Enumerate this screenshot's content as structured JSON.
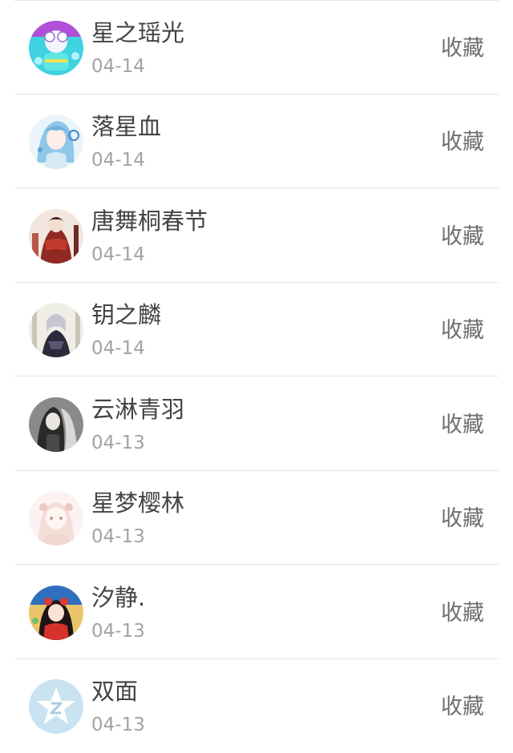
{
  "users": [
    {
      "name": "星之瑶光",
      "date": "04-14",
      "action": "收藏",
      "avatar_icon": "anime-cat-ears-avatar-icon"
    },
    {
      "name": "落星血",
      "date": "04-14",
      "action": "收藏",
      "avatar_icon": "anime-blue-hair-avatar-icon"
    },
    {
      "name": "唐舞桐春节",
      "date": "04-14",
      "action": "收藏",
      "avatar_icon": "anime-red-dress-avatar-icon"
    },
    {
      "name": "钥之麟",
      "date": "04-14",
      "action": "收藏",
      "avatar_icon": "anime-dark-dress-avatar-icon"
    },
    {
      "name": "云淋青羽",
      "date": "04-13",
      "action": "收藏",
      "avatar_icon": "anime-grey-sketch-avatar-icon"
    },
    {
      "name": "星梦樱林",
      "date": "04-13",
      "action": "收藏",
      "avatar_icon": "anime-pastel-avatar-icon"
    },
    {
      "name": "汐静.",
      "date": "04-13",
      "action": "收藏",
      "avatar_icon": "anime-red-girl-avatar-icon"
    },
    {
      "name": "双面",
      "date": "04-13",
      "action": "收藏",
      "avatar_icon": "default-star-avatar-icon"
    }
  ],
  "colors": {
    "name_text": "#444444",
    "date_text": "#a3a3a3",
    "action_text": "#6f6f6f",
    "divider": "#e6e6e6"
  }
}
